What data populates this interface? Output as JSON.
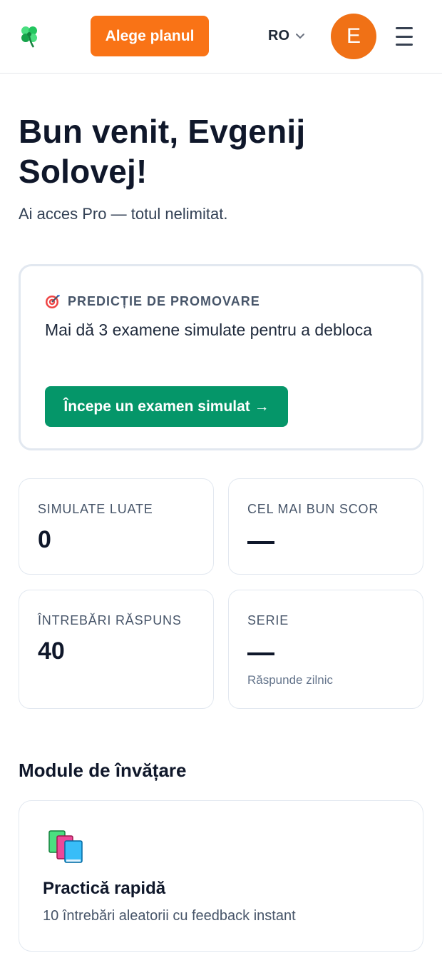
{
  "header": {
    "logo_icon": "four-leaf-clover-icon",
    "plan_button": "Alege planul",
    "language": "RO",
    "avatar_initial": "E",
    "menu_icon": "hamburger-menu-icon",
    "accent_color": "#f97316"
  },
  "welcome": {
    "title": "Bun venit, Evgenij Solovej!",
    "subtitle": "Ai acces Pro — totul nelimitat."
  },
  "prediction": {
    "icon": "target-icon",
    "heading": "PREDICȚIE DE PROMOVARE",
    "text": "Mai dă 3 examene simulate pentru a debloca",
    "button": "Începe un examen simulat →",
    "button_color": "#059669"
  },
  "stats": [
    {
      "label": "SIMULATE LUATE",
      "value": "0"
    },
    {
      "label": "CEL MAI BUN SCOR",
      "value": "—"
    },
    {
      "label": "ÎNTREBĂRI RĂSPUNS",
      "value": "40"
    },
    {
      "label": "SERIE",
      "value": "—",
      "note": "Răspunde zilnic"
    }
  ],
  "modules": {
    "section_title": "Module de învățare",
    "items": [
      {
        "icon": "books-icon",
        "title": "Practică rapidă",
        "description": "10 întrebări aleatorii cu feedback instant"
      }
    ]
  }
}
